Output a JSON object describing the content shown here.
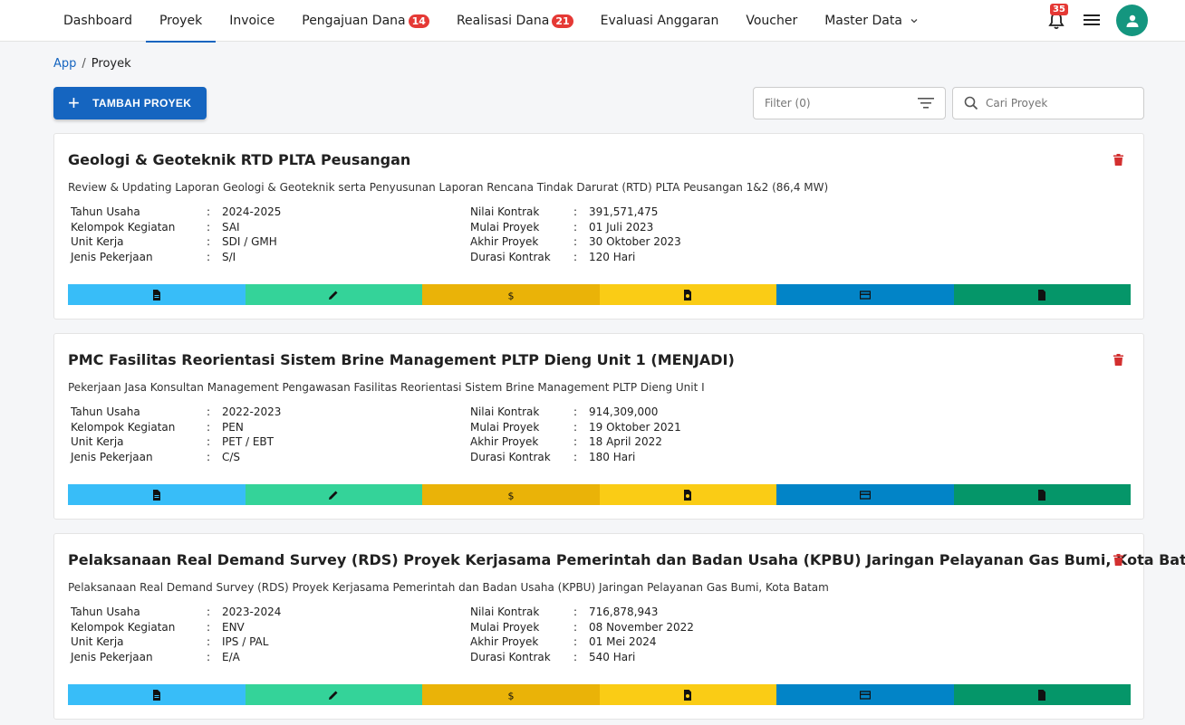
{
  "nav": {
    "items": [
      {
        "label": "Dashboard"
      },
      {
        "label": "Proyek",
        "active": true
      },
      {
        "label": "Invoice"
      },
      {
        "label": "Pengajuan Dana",
        "badge": "14"
      },
      {
        "label": "Realisasi Dana",
        "badge": "21"
      },
      {
        "label": "Evaluasi Anggaran"
      },
      {
        "label": "Voucher"
      },
      {
        "label": "Master Data",
        "dropdown": true
      }
    ],
    "notification_count": "35",
    "icons": [
      "bell-icon",
      "hamburger-menu-icon",
      "user-avatar-icon"
    ]
  },
  "breadcrumb": {
    "root": "App",
    "separator": "/",
    "current": "Proyek"
  },
  "toolbar": {
    "add_label": "TAMBAH PROYEK",
    "filter_label": "Filter (0)",
    "search_placeholder": "Cari Proyek"
  },
  "labels": {
    "tahun": "Tahun Usaha",
    "kelompok": "Kelompok Kegiatan",
    "unit": "Unit Kerja",
    "jenis": "Jenis Pekerjaan",
    "nilai": "Nilai Kontrak",
    "mulai": "Mulai Proyek",
    "akhir": "Akhir Proyek",
    "durasi": "Durasi Kontrak",
    "colon": ":"
  },
  "projects": [
    {
      "title": "Geologi & Geoteknik RTD PLTA Peusangan",
      "description": "Review & Updating Laporan Geologi & Geoteknik serta Penyusunan Laporan Rencana Tindak Darurat (RTD) PLTA Peusangan 1&2 (86,4 MW)",
      "tahun": "2024-2025",
      "kelompok": "SAI",
      "unit": "SDI / GMH",
      "jenis": "S/I",
      "nilai": "391,571,475",
      "mulai": "01 Juli 2023",
      "akhir": "30 Oktober 2023",
      "durasi": "120 Hari"
    },
    {
      "title": "PMC Fasilitas Reorientasi Sistem Brine Management PLTP Dieng Unit 1 (MENJADI)",
      "description": "Pekerjaan Jasa Konsultan Management Pengawasan Fasilitas Reorientasi Sistem Brine Management PLTP Dieng Unit I",
      "tahun": "2022-2023",
      "kelompok": "PEN",
      "unit": "PET / EBT",
      "jenis": "C/S",
      "nilai": "914,309,000",
      "mulai": "19 Oktober 2021",
      "akhir": "18 April 2022",
      "durasi": "180 Hari"
    },
    {
      "title": "Pelaksanaan Real Demand Survey (RDS) Proyek Kerjasama Pemerintah dan Badan Usaha (KPBU) Jaringan Pelayanan Gas Bumi, Kota Batam",
      "description": "Pelaksanaan Real Demand Survey (RDS) Proyek Kerjasama Pemerintah dan Badan Usaha (KPBU) Jaringan Pelayanan Gas Bumi, Kota Batam",
      "tahun": "2023-2024",
      "kelompok": "ENV",
      "unit": "IPS / PAL",
      "jenis": "E/A",
      "nilai": "716,878,943",
      "mulai": "08 November 2022",
      "akhir": "01 Mei 2024",
      "durasi": "540 Hari"
    }
  ],
  "action_bar": [
    {
      "icon": "document-icon",
      "color": "#38bdf8"
    },
    {
      "icon": "pencil-icon",
      "color": "#34d399"
    },
    {
      "icon": "dollar-icon",
      "color": "#eab308"
    },
    {
      "icon": "file-badge-icon",
      "color": "#facc15"
    },
    {
      "icon": "card-icon",
      "color": "#0284c7"
    },
    {
      "icon": "file-icon",
      "color": "#059669"
    }
  ]
}
